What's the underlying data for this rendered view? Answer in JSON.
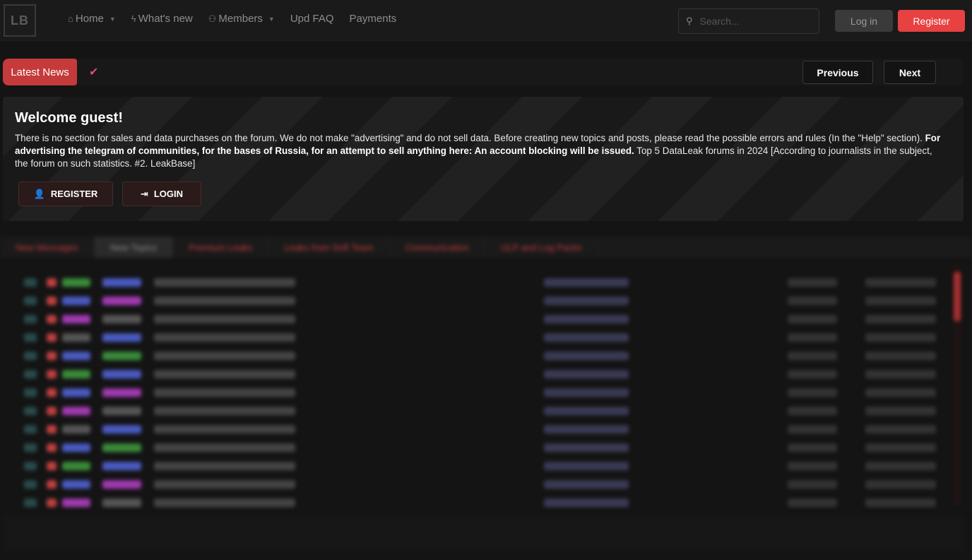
{
  "header": {
    "logo_text": "LB",
    "nav": [
      {
        "label": "Home",
        "icon": "home-icon",
        "has_caret": true
      },
      {
        "label": "What's new",
        "icon": "bolt-icon",
        "has_caret": false
      },
      {
        "label": "Members",
        "icon": "users-icon",
        "has_caret": true
      },
      {
        "label": "Upd FAQ",
        "icon": "",
        "has_caret": false
      },
      {
        "label": "Payments",
        "icon": "",
        "has_caret": false
      }
    ],
    "search_placeholder": "Search...",
    "login_label": "Log in",
    "register_label": "Register"
  },
  "newsbar": {
    "tag_label": "Latest News",
    "prev_label": "Previous",
    "next_label": "Next"
  },
  "welcome": {
    "title": "Welcome guest!",
    "text_1": "There is no section for sales and data purchases on the forum. We do not make \"advertising\" and do not sell data. Before creating new topics and posts, please read the possible errors and rules (In the \"Help\" section). ",
    "text_bold": "For advertising the telegram of communities, for the bases of Russia, for an attempt to sell anything here: An account blocking will be issued.",
    "text_2": " Top 5 DataLeak forums in 2024 [According to journalists in the subject, the forum on such statistics. #2. LeakBase]",
    "register_label": "REGISTER",
    "login_label": "LOGIN"
  },
  "threads": {
    "tabs": [
      "New Messages",
      "New Topics",
      "Premium Leaks",
      "Leaks from Soft Team",
      "Communication",
      "ULP and Log Packs"
    ],
    "active_tab": 1,
    "row_count": 13
  },
  "colors": {
    "accent": "#e84141",
    "news_tag": "#c53a3a",
    "background": "#141414"
  }
}
